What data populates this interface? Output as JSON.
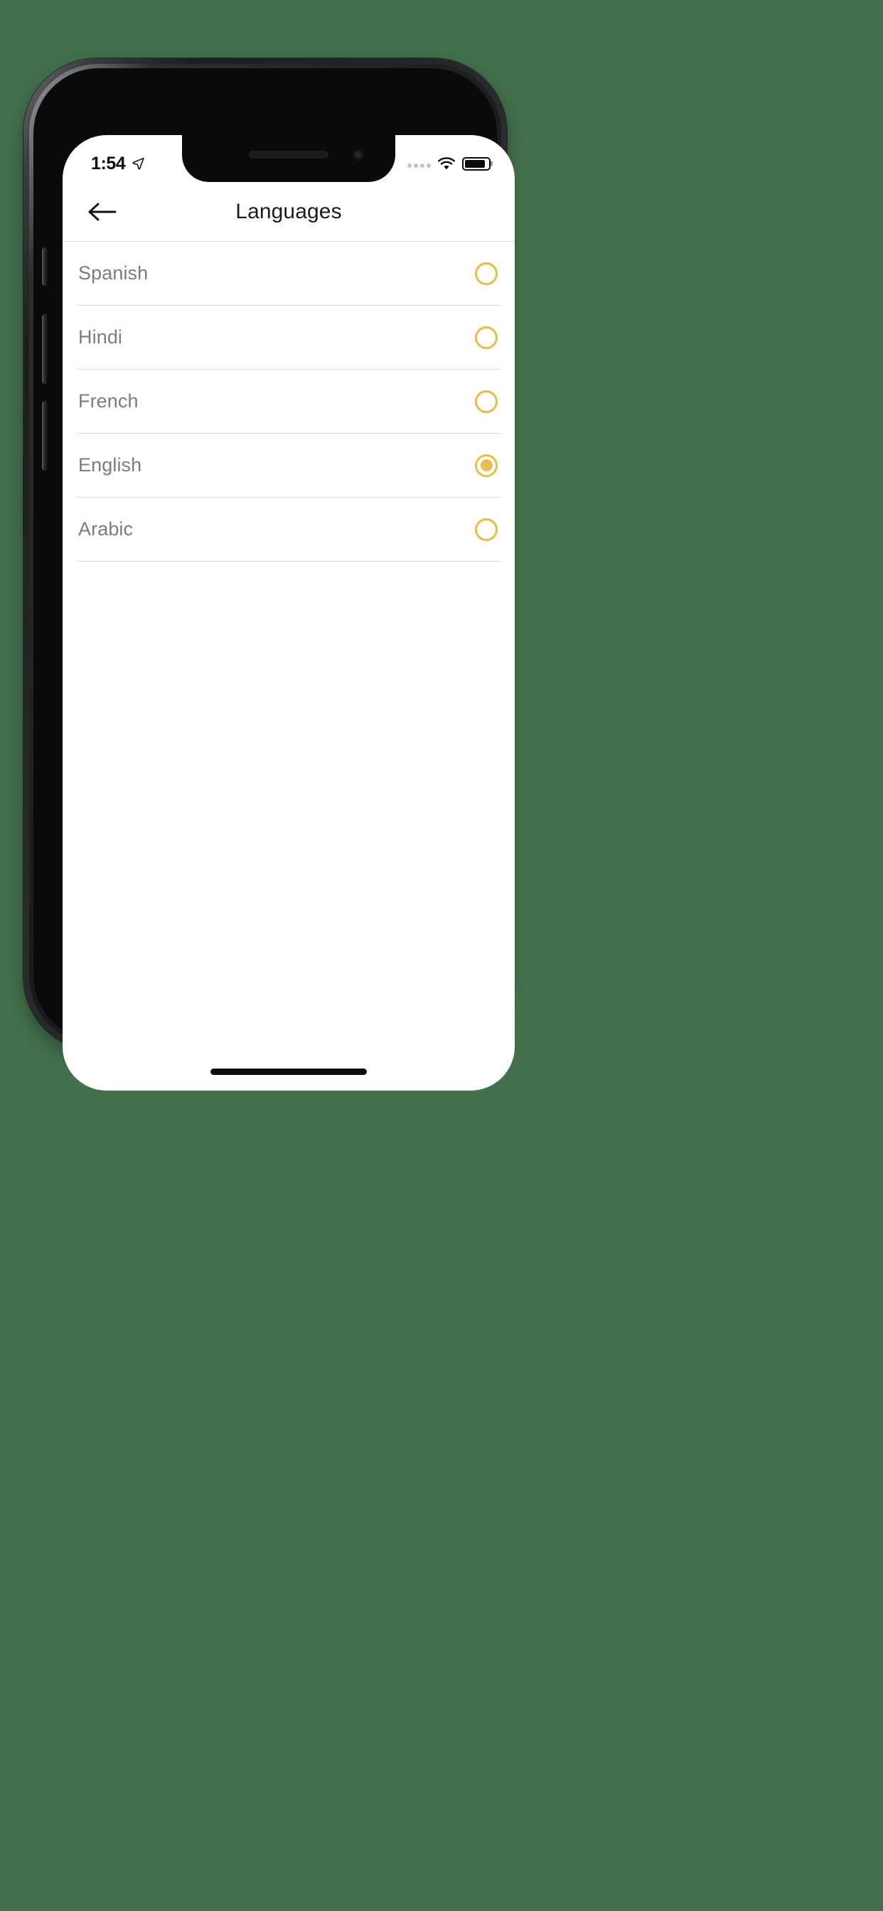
{
  "theme": {
    "page_background": "#44704e",
    "screen_background": "#ffffff",
    "accent_gold": "#e5bf52",
    "label_gray": "#7c7c7c",
    "title_black": "#1c1c1c",
    "separator": "#dcdcdc"
  },
  "status_bar": {
    "time": "1:54",
    "location_icon": "location-arrow-icon",
    "signal_icon": "cellular-dots-icon",
    "wifi_icon": "wifi-icon",
    "battery_icon": "battery-icon",
    "battery_level": "88%"
  },
  "nav_bar": {
    "back_icon": "arrow-left-icon",
    "title": "Languages"
  },
  "language_list": {
    "items": [
      {
        "label": "Spanish",
        "selected": false
      },
      {
        "label": "Hindi",
        "selected": false
      },
      {
        "label": "French",
        "selected": false
      },
      {
        "label": "English",
        "selected": true
      },
      {
        "label": "Arabic",
        "selected": false
      }
    ]
  },
  "home_indicator": {
    "name": "home-indicator"
  }
}
